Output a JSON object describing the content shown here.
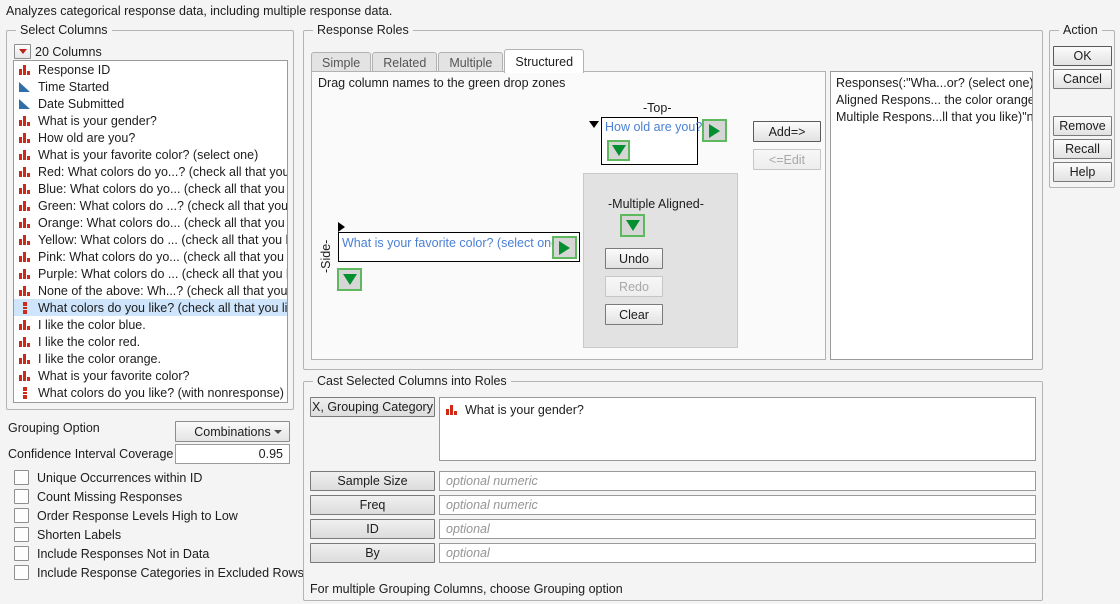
{
  "description": "Analyzes categorical response data, including multiple response data.",
  "select_columns": {
    "title": "Select Columns",
    "count_label": "20 Columns",
    "items": [
      {
        "label": "Response ID",
        "icon": "nominal-bar-icon",
        "selected": false
      },
      {
        "label": "Time Started",
        "icon": "continuous-triangle-icon",
        "selected": false
      },
      {
        "label": "Date Submitted",
        "icon": "continuous-triangle-icon",
        "selected": false
      },
      {
        "label": "What is your gender?",
        "icon": "nominal-bar-icon",
        "selected": false
      },
      {
        "label": "How old are you?",
        "icon": "nominal-bar-icon",
        "selected": false
      },
      {
        "label": "What is your favorite color? (select one)",
        "icon": "nominal-bar-icon",
        "selected": false
      },
      {
        "label": "Red: What colors do yo...? (check all that you like)",
        "icon": "nominal-bar-icon",
        "selected": false
      },
      {
        "label": "Blue: What colors do yo... (check all that you like)",
        "icon": "nominal-bar-icon",
        "selected": false
      },
      {
        "label": "Green: What colors do ...? (check all that you like)",
        "icon": "nominal-bar-icon",
        "selected": false
      },
      {
        "label": "Orange: What colors do... (check all that you like)",
        "icon": "nominal-bar-icon",
        "selected": false
      },
      {
        "label": "Yellow: What colors do ... (check all that you like)",
        "icon": "nominal-bar-icon",
        "selected": false
      },
      {
        "label": "Pink: What colors do yo... (check all that you like)",
        "icon": "nominal-bar-icon",
        "selected": false
      },
      {
        "label": "Purple: What colors do ... (check all that you like)",
        "icon": "nominal-bar-icon",
        "selected": false
      },
      {
        "label": "None of the above: Wh...? (check all that you like)",
        "icon": "nominal-bar-icon",
        "selected": false
      },
      {
        "label": "What colors do you like? (check all that you like)",
        "icon": "multiple-response-icon",
        "selected": true
      },
      {
        "label": "I like the color blue.",
        "icon": "nominal-bar-icon",
        "selected": false
      },
      {
        "label": "I like the color red.",
        "icon": "nominal-bar-icon",
        "selected": false
      },
      {
        "label": "I like the color orange.",
        "icon": "nominal-bar-icon",
        "selected": false
      },
      {
        "label": "What is your favorite color?",
        "icon": "nominal-bar-icon",
        "selected": false
      },
      {
        "label": "What colors do you like? (with nonresponse)",
        "icon": "multiple-response-icon",
        "selected": false
      }
    ]
  },
  "options": {
    "grouping_option_label": "Grouping Option",
    "grouping_option_value": "Combinations",
    "confidence_label": "Confidence Interval Coverage",
    "confidence_value": "0.95",
    "checkboxes": [
      {
        "label": "Unique Occurrences within ID",
        "checked": false
      },
      {
        "label": "Count Missing Responses",
        "checked": false
      },
      {
        "label": "Order Response Levels High to Low",
        "checked": false
      },
      {
        "label": "Shorten Labels",
        "checked": false
      },
      {
        "label": "Include Responses Not in Data",
        "checked": false
      },
      {
        "label": "Include Response Categories in Excluded Rows",
        "checked": false
      }
    ]
  },
  "response_roles": {
    "title": "Response Roles",
    "tabs": [
      {
        "label": "Simple",
        "active": false
      },
      {
        "label": "Related",
        "active": false
      },
      {
        "label": "Multiple",
        "active": false
      },
      {
        "label": "Structured",
        "active": true
      }
    ],
    "hint": "Drag column names to the green drop zones",
    "top_zone": {
      "label": "-Top-",
      "value": "How old are you?"
    },
    "side_zone": {
      "label": "-Side-",
      "value": "What is your favorite color? (select one)"
    },
    "multiple_aligned": {
      "label": "-Multiple Aligned-",
      "undo_label": "Undo",
      "redo_label": "Redo",
      "clear_label": "Clear",
      "redo_disabled": true
    },
    "add_label": "Add=>",
    "edit_label": "<=Edit",
    "edit_disabled": true,
    "script_lines": [
      "Responses(:\"Wha...or? (select one)\"n)",
      "Aligned Respons... the color orange.)",
      "Multiple Respons...ll that you like)\"n)"
    ]
  },
  "cast_roles": {
    "title": "Cast Selected Columns into Roles",
    "rows": [
      {
        "button": "X, Grouping Category",
        "value": "What is your gender?",
        "value_icon": "nominal-bar-icon",
        "placeholder": "",
        "tall": true
      },
      {
        "button": "Sample Size",
        "value": "",
        "placeholder": "optional numeric",
        "tall": false
      },
      {
        "button": "Freq",
        "value": "",
        "placeholder": "optional numeric",
        "tall": false
      },
      {
        "button": "ID",
        "value": "",
        "placeholder": "optional",
        "tall": false
      },
      {
        "button": "By",
        "value": "",
        "placeholder": "optional",
        "tall": false
      }
    ],
    "footer": "For multiple Grouping Columns, choose Grouping option"
  },
  "action": {
    "title": "Action",
    "buttons": [
      {
        "label": "OK",
        "default": true
      },
      {
        "label": "Cancel",
        "default": false
      }
    ],
    "buttons2": [
      {
        "label": "Remove",
        "default": false
      },
      {
        "label": "Recall",
        "default": false
      },
      {
        "label": "Help",
        "default": false
      }
    ]
  }
}
